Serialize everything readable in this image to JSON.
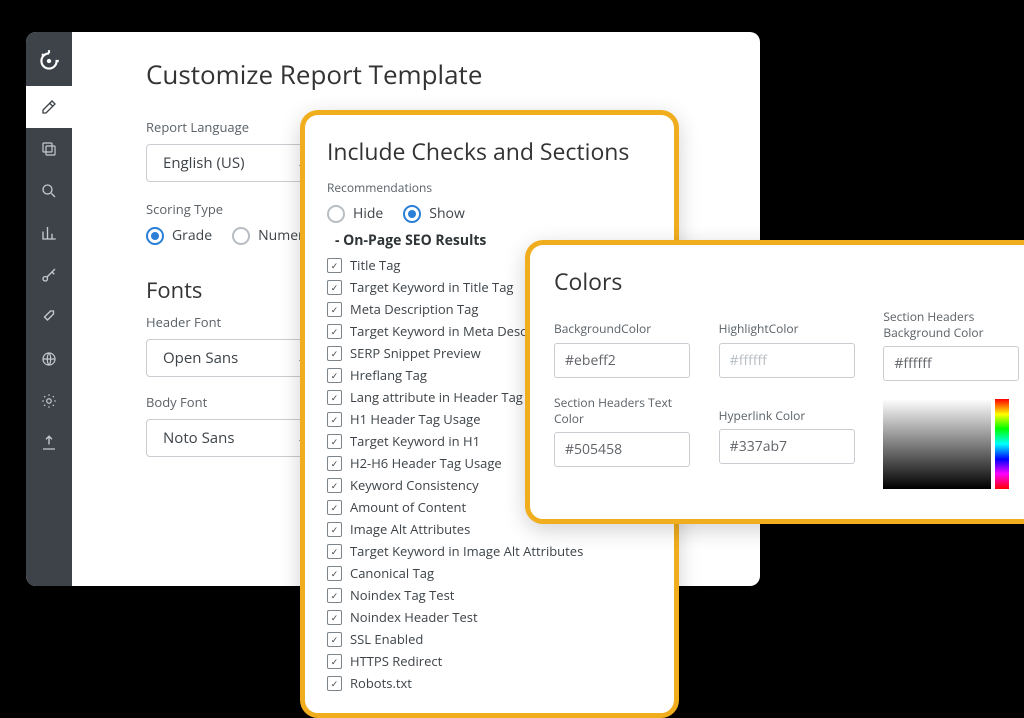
{
  "page_title": "Customize Report Template",
  "labels": {
    "report_language": "Report Language",
    "scoring_type": "Scoring Type",
    "fonts": "Fonts",
    "header_font": "Header Font",
    "body_font": "Body Font"
  },
  "report_language": {
    "selected": "English (US)"
  },
  "scoring": {
    "grade_label": "Grade",
    "numeric_label": "Numeric",
    "selected": "grade"
  },
  "fonts": {
    "header": "Open Sans",
    "body": "Noto Sans"
  },
  "checks_panel": {
    "title": "Include Checks and Sections",
    "recommendations_label": "Recommendations",
    "hide": "Hide",
    "show": "Show",
    "recommendations": "show",
    "section_header": "On-Page SEO Results",
    "items": [
      "Title Tag",
      "Target Keyword in Title Tag",
      "Meta Description Tag",
      "Target Keyword in Meta Description",
      "SERP Snippet Preview",
      "Hreflang Tag",
      "Lang attribute in Header Tag",
      "H1 Header Tag Usage",
      "Target Keyword in H1",
      "H2-H6 Header Tag Usage",
      "Keyword Consistency",
      "Amount of Content",
      "Image Alt Attributes",
      "Target Keyword in Image Alt Attributes",
      "Canonical Tag",
      "Noindex Tag Test",
      "Noindex Header Test",
      "SSL Enabled",
      "HTTPS Redirect",
      "Robots.txt"
    ]
  },
  "colors_panel": {
    "title": "Colors",
    "fields": {
      "background": {
        "label": "BackgroundColor",
        "value": "#ebeff2"
      },
      "highlight": {
        "label": "HighlightColor",
        "placeholder": "#ffffff"
      },
      "section_bg": {
        "label": "Section Headers Background Color",
        "value": "#ffffff"
      },
      "section_text": {
        "label": "Section Headers Text Color",
        "value": "#505458"
      },
      "hyperlink": {
        "label": "Hyperlink Color",
        "value": "#337ab7"
      }
    }
  }
}
